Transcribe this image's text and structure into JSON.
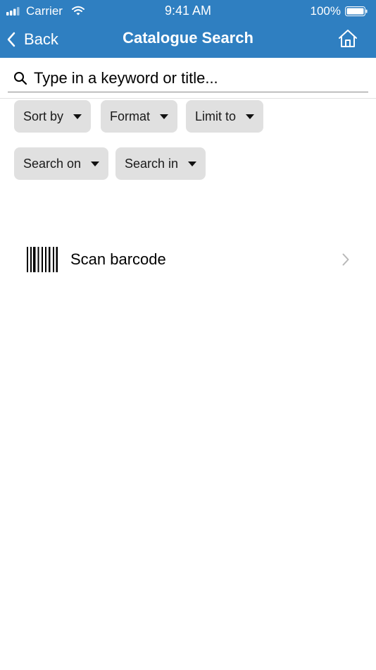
{
  "status_bar": {
    "carrier": "Carrier",
    "time": "9:41 AM",
    "battery": "100%"
  },
  "nav": {
    "back_label": "Back",
    "title": "Catalogue Search"
  },
  "search": {
    "placeholder": "Type in a keyword or title..."
  },
  "filters": {
    "row1": [
      "Sort by",
      "Format",
      "Limit to"
    ],
    "row2": [
      "Search on",
      "Search in"
    ]
  },
  "scan": {
    "label": "Scan barcode"
  },
  "colors": {
    "accent": "#2f7fc1",
    "chip_bg": "#e0e0e0"
  }
}
